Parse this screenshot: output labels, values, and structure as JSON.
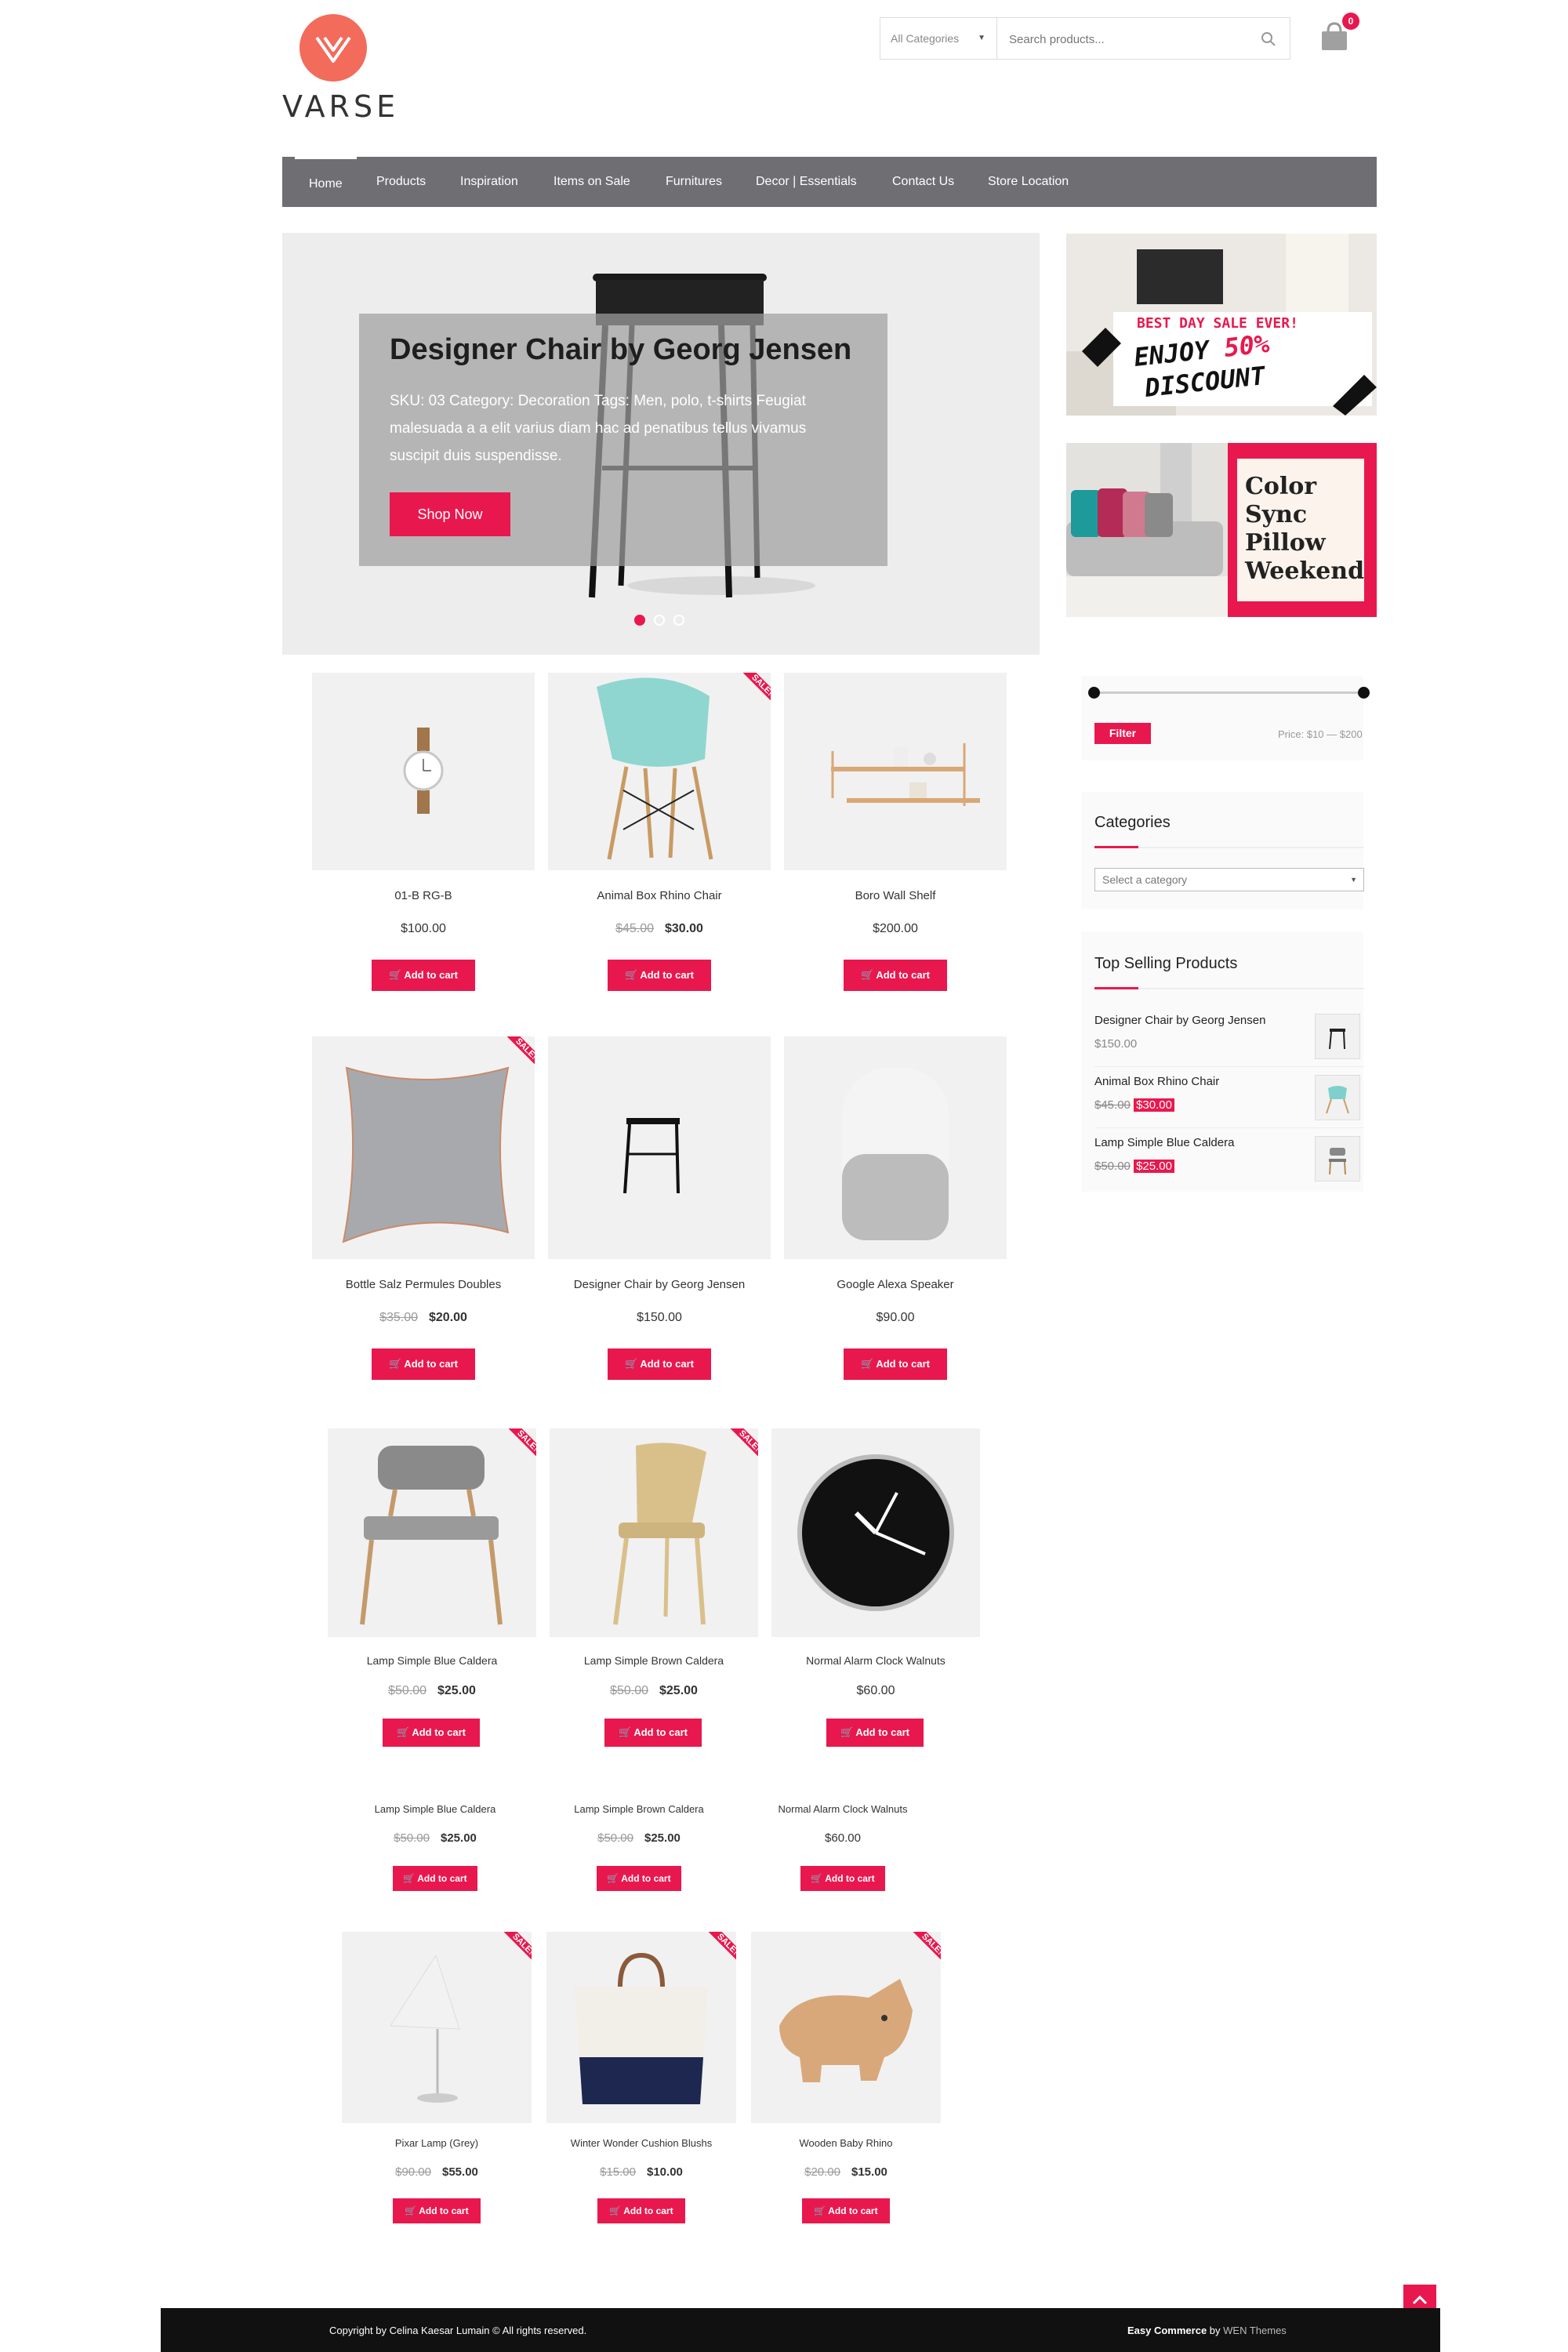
{
  "header": {
    "logo_text": "VARSE",
    "category_select": "All Categories",
    "search_placeholder": "Search products...",
    "cart_count": "0"
  },
  "nav": {
    "items": [
      "Home",
      "Products",
      "Inspiration",
      "Items on Sale",
      "Furnitures",
      "Decor | Essentials",
      "Contact Us",
      "Store Location"
    ]
  },
  "hero": {
    "title": "Designer Chair by Georg Jensen",
    "description": "SKU: 03 Category: Decoration Tags: Men, polo, t-shirts Feugiat malesuada a a elit varius diam hac ad penatibus tellus vivamus suscipit duis suspendisse.",
    "button": "Shop Now"
  },
  "banners": {
    "sale_line1": "BEST DAY SALE EVER!",
    "sale_line2": "ENJOY",
    "sale_percent": "50%",
    "sale_line3": "DISCOUNT",
    "pillow_lines": [
      "Color",
      "Sync",
      "Pillow",
      "Weekend"
    ]
  },
  "products": {
    "add_label": "Add to cart",
    "sale_label": "SALE!",
    "grid1": [
      {
        "name": "01-B RG-B",
        "price": "$100.00"
      },
      {
        "name": "Animal Box Rhino Chair",
        "old": "$45.00",
        "price": "$30.00"
      },
      {
        "name": "Boro Wall Shelf",
        "price": "$200.00"
      },
      {
        "name": "Bottle Salz Permules Doubles",
        "old": "$35.00",
        "price": "$20.00"
      },
      {
        "name": "Designer Chair by Georg Jensen",
        "price": "$150.00"
      },
      {
        "name": "Google Alexa Speaker",
        "price": "$90.00"
      }
    ],
    "grid2": [
      {
        "name": "Lamp Simple Blue Caldera",
        "old": "$50.00",
        "price": "$25.00"
      },
      {
        "name": "Lamp Simple Brown Caldera",
        "old": "$50.00",
        "price": "$25.00"
      },
      {
        "name": "Normal Alarm Clock Walnuts",
        "price": "$60.00"
      }
    ],
    "grid3": [
      {
        "name": "Lamp Simple Blue Caldera",
        "old": "$50.00",
        "price": "$25.00"
      },
      {
        "name": "Lamp Simple Brown Caldera",
        "old": "$50.00",
        "price": "$25.00"
      },
      {
        "name": "Normal Alarm Clock Walnuts",
        "price": "$60.00"
      }
    ],
    "grid4": [
      {
        "name": "Pixar Lamp (Grey)",
        "old": "$90.00",
        "price": "$55.00"
      },
      {
        "name": "Winter Wonder Cushion Blushs",
        "old": "$15.00",
        "price": "$10.00"
      },
      {
        "name": "Wooden Baby Rhino",
        "old": "$20.00",
        "price": "$15.00"
      }
    ]
  },
  "sidebar": {
    "filter_button": "Filter",
    "price_range": "Price: $10 — $200",
    "categories_title": "Categories",
    "category_placeholder": "Select a category",
    "top_selling_title": "Top Selling Products",
    "top_selling": [
      {
        "name": "Designer Chair by Georg Jensen",
        "price": "$150.00"
      },
      {
        "name": "Animal Box Rhino Chair",
        "old": "$45.00",
        "price": "$30.00"
      },
      {
        "name": "Lamp Simple Blue Caldera",
        "old": "$50.00",
        "price": "$25.00"
      }
    ]
  },
  "footer": {
    "copyright": "Copyright by Celina Kaesar Lumain © All rights reserved.",
    "credit_prefix": "Easy Commerce",
    "credit_by": " by ",
    "credit_link": "WEN Themes"
  },
  "colors": {
    "accent": "#e8184e",
    "nav": "#6f6f73",
    "logo": "#f26b5b"
  }
}
